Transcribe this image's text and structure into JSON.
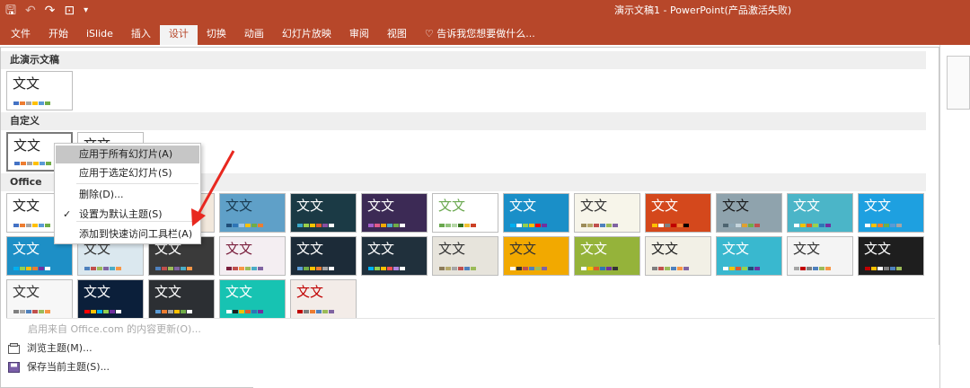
{
  "window": {
    "title": "演示文稿1 - PowerPoint(产品激活失败)",
    "qat_icons": [
      "save-icon",
      "undo-icon",
      "redo-icon",
      "start-from-beginning-icon",
      "customize-qat-icon"
    ]
  },
  "ribbon": {
    "tabs": [
      {
        "label": "文件",
        "active": false
      },
      {
        "label": "开始",
        "active": false
      },
      {
        "label": "iSlide",
        "active": false
      },
      {
        "label": "插入",
        "active": false
      },
      {
        "label": "设计",
        "active": true
      },
      {
        "label": "切换",
        "active": false
      },
      {
        "label": "动画",
        "active": false
      },
      {
        "label": "幻灯片放映",
        "active": false
      },
      {
        "label": "审阅",
        "active": false
      },
      {
        "label": "视图",
        "active": false
      }
    ],
    "tell_me": "告诉我您想要做什么..."
  },
  "gallery": {
    "sections": {
      "this_presentation": "此演示文稿",
      "custom": "自定义",
      "office": "Office"
    },
    "thumb_text": "文文",
    "this_presentation_themes": [
      {
        "bg": "#ffffff",
        "fg": "#222222",
        "swatches": [
          "#4472c4",
          "#ed7d31",
          "#a5a5a5",
          "#ffc000",
          "#5b9bd5",
          "#70ad47"
        ]
      }
    ],
    "custom_themes": [
      {
        "bg": "#ffffff",
        "fg": "#222222",
        "swatches": [
          "#4472c4",
          "#ed7d31",
          "#a5a5a5",
          "#ffc000",
          "#5b9bd5",
          "#70ad47"
        ]
      },
      {
        "bg": "#ffffff",
        "fg": "#222222",
        "swatches": [
          "#4472c4",
          "#ed7d31",
          "#a5a5a5",
          "#ffc000",
          "#5b9bd5",
          "#70ad47"
        ]
      }
    ],
    "office_themes": [
      {
        "bg": "#ffffff",
        "fg": "#222222",
        "swatches": [
          "#4472c4",
          "#ed7d31",
          "#a5a5a5",
          "#ffc000",
          "#5b9bd5",
          "#70ad47"
        ]
      },
      {
        "bg": "#e8f0f6",
        "fg": "#222222",
        "swatches": [
          "#5b9bd5",
          "#ed7d31",
          "#a5a5a5",
          "#ffc000",
          "#4472c4",
          "#70ad47"
        ]
      },
      {
        "bg": "#f2e8dc",
        "fg": "#222222",
        "swatches": [
          "#c0504d",
          "#9bbb59",
          "#8064a2",
          "#4bacc6",
          "#f79646",
          "#4f81bd"
        ]
      },
      {
        "bg": "#5fa0c8",
        "fg": "#1a3a50",
        "swatches": [
          "#1f4e79",
          "#2e75b6",
          "#9dc3e6",
          "#ffc000",
          "#70ad47",
          "#ed7d31"
        ]
      },
      {
        "bg": "#1b3a45",
        "fg": "#ffffff",
        "swatches": [
          "#3aa8c8",
          "#9ad14b",
          "#f2c300",
          "#e05a2b",
          "#8a4fa0",
          "#ffffff"
        ]
      },
      {
        "bg": "#3c2a55",
        "fg": "#ffffff",
        "swatches": [
          "#a25ecb",
          "#e05a8a",
          "#f2a900",
          "#4bacc6",
          "#70ad47",
          "#ffffff"
        ]
      },
      {
        "bg": "#ffffff",
        "fg": "#6aa84f",
        "swatches": [
          "#6aa84f",
          "#93c47d",
          "#b6d7a8",
          "#38761d",
          "#f1c232",
          "#cc4125"
        ]
      },
      {
        "bg": "#1a8fc8",
        "fg": "#ffffff",
        "swatches": [
          "#00b0f0",
          "#ffffff",
          "#92d050",
          "#ffc000",
          "#ff0000",
          "#7030a0"
        ]
      },
      {
        "bg": "#f7f5ea",
        "fg": "#333333",
        "swatches": [
          "#9c8c5a",
          "#b6a86a",
          "#c0504d",
          "#4f81bd",
          "#9bbb59",
          "#8064a2"
        ]
      },
      {
        "bg": "#d4481c",
        "fg": "#ffffff",
        "swatches": [
          "#ffc000",
          "#ffffff",
          "#7f7f7f",
          "#c00000",
          "#ed7d31",
          "#000000"
        ]
      },
      {
        "bg": "#8fa3ad",
        "fg": "#1a1a1a",
        "swatches": [
          "#4d6470",
          "#8ea8b6",
          "#c4d4dc",
          "#e0a030",
          "#70ad47",
          "#c0504d"
        ]
      },
      {
        "bg": "#4bb5c8",
        "fg": "#ffffff",
        "swatches": [
          "#ffffff",
          "#f2c300",
          "#e05a2b",
          "#9ad14b",
          "#2e75b6",
          "#7030a0"
        ]
      },
      {
        "bg": "#1ea0e0",
        "fg": "#ffffff",
        "swatches": [
          "#ffffff",
          "#ffc000",
          "#ed7d31",
          "#70ad47",
          "#5b9bd5",
          "#a5a5a5"
        ]
      },
      {
        "bg": "#1d8fc6",
        "fg": "#ffffff",
        "swatches": [
          "#00b0f0",
          "#92d050",
          "#ffc000",
          "#ed7d31",
          "#7030a0",
          "#ffffff"
        ]
      },
      {
        "bg": "#dbe8ef",
        "fg": "#333333",
        "swatches": [
          "#4f81bd",
          "#c0504d",
          "#9bbb59",
          "#8064a2",
          "#4bacc6",
          "#f79646"
        ]
      },
      {
        "bg": "#3a3a3a",
        "fg": "#ffffff",
        "swatches": [
          "#4f81bd",
          "#c0504d",
          "#9bbb59",
          "#8064a2",
          "#4bacc6",
          "#f79646"
        ]
      },
      {
        "bg": "#f4eef2",
        "fg": "#7a1f3d",
        "swatches": [
          "#7a1f3d",
          "#c0504d",
          "#f79646",
          "#9bbb59",
          "#4bacc6",
          "#8064a2"
        ]
      },
      {
        "bg": "#1c2b38",
        "fg": "#ffffff",
        "swatches": [
          "#5b9bd5",
          "#70ad47",
          "#ffc000",
          "#ed7d31",
          "#a5a5a5",
          "#ffffff"
        ]
      },
      {
        "bg": "#20303c",
        "fg": "#ffffff",
        "swatches": [
          "#00b0f0",
          "#92d050",
          "#ffc000",
          "#ff5050",
          "#b084e0",
          "#ffffff"
        ]
      },
      {
        "bg": "#e7e4dc",
        "fg": "#333333",
        "swatches": [
          "#8c7b5a",
          "#b6a86a",
          "#a5a5a5",
          "#c0504d",
          "#4f81bd",
          "#9bbb59"
        ]
      },
      {
        "bg": "#f2a900",
        "fg": "#333333",
        "swatches": [
          "#ffffff",
          "#333333",
          "#c0504d",
          "#4f81bd",
          "#9bbb59",
          "#8064a2"
        ]
      },
      {
        "bg": "#95b33a",
        "fg": "#ffffff",
        "swatches": [
          "#ffffff",
          "#f2c300",
          "#e05a2b",
          "#2e75b6",
          "#7030a0",
          "#333333"
        ]
      },
      {
        "bg": "#f2f0e6",
        "fg": "#222222",
        "swatches": [
          "#7f7f7f",
          "#c0504d",
          "#9bbb59",
          "#4f81bd",
          "#f79646",
          "#8064a2"
        ]
      },
      {
        "bg": "#39b8cf",
        "fg": "#ffffff",
        "swatches": [
          "#ffffff",
          "#f2c300",
          "#e05a2b",
          "#9ad14b",
          "#1f4e79",
          "#7030a0"
        ]
      },
      {
        "bg": "#f4f4f4",
        "fg": "#333333",
        "swatches": [
          "#a5a5a5",
          "#c00000",
          "#7f7f7f",
          "#4f81bd",
          "#9bbb59",
          "#f79646"
        ]
      },
      {
        "bg": "#1e1e1e",
        "fg": "#ffffff",
        "swatches": [
          "#c00000",
          "#ffc000",
          "#ffffff",
          "#7f7f7f",
          "#4f81bd",
          "#9bbb59"
        ]
      },
      {
        "bg": "#f7f7f7",
        "fg": "#333333",
        "swatches": [
          "#7f7f7f",
          "#a5a5a5",
          "#4f81bd",
          "#c0504d",
          "#9bbb59",
          "#f79646"
        ]
      },
      {
        "bg": "#0b1f3a",
        "fg": "#ffffff",
        "swatches": [
          "#ff0000",
          "#ffc000",
          "#00b0f0",
          "#92d050",
          "#7030a0",
          "#ffffff"
        ]
      },
      {
        "bg": "#2c2f33",
        "fg": "#ffffff",
        "swatches": [
          "#5b9bd5",
          "#ed7d31",
          "#a5a5a5",
          "#ffc000",
          "#70ad47",
          "#ffffff"
        ]
      },
      {
        "bg": "#17c3b2",
        "fg": "#ffffff",
        "swatches": [
          "#ffffff",
          "#1e1e1e",
          "#f2c300",
          "#e05a2b",
          "#2e75b6",
          "#7030a0"
        ]
      },
      {
        "bg": "#f3ece8",
        "fg": "#c00000",
        "swatches": [
          "#c00000",
          "#7f7f7f",
          "#ed7d31",
          "#4f81bd",
          "#9bbb59",
          "#8064a2"
        ]
      }
    ]
  },
  "context_menu": {
    "items": [
      {
        "label": "应用于所有幻灯片(A)",
        "hover": true,
        "checked": false
      },
      {
        "label": "应用于选定幻灯片(S)",
        "hover": false,
        "checked": false
      },
      {
        "label": "删除(D)...",
        "hover": false,
        "checked": false
      },
      {
        "label": "设置为默认主题(S)",
        "hover": false,
        "checked": true
      },
      {
        "label": "添加到快速访问工具栏(A)",
        "hover": false,
        "checked": false
      }
    ]
  },
  "footer_links": {
    "enable_updates": "启用来自 Office.com 的内容更新(O)...",
    "browse_themes": "浏览主题(M)...",
    "save_theme": "保存当前主题(S)..."
  },
  "colors": {
    "accent": "#b7472a",
    "arrow": "#e8281f"
  }
}
